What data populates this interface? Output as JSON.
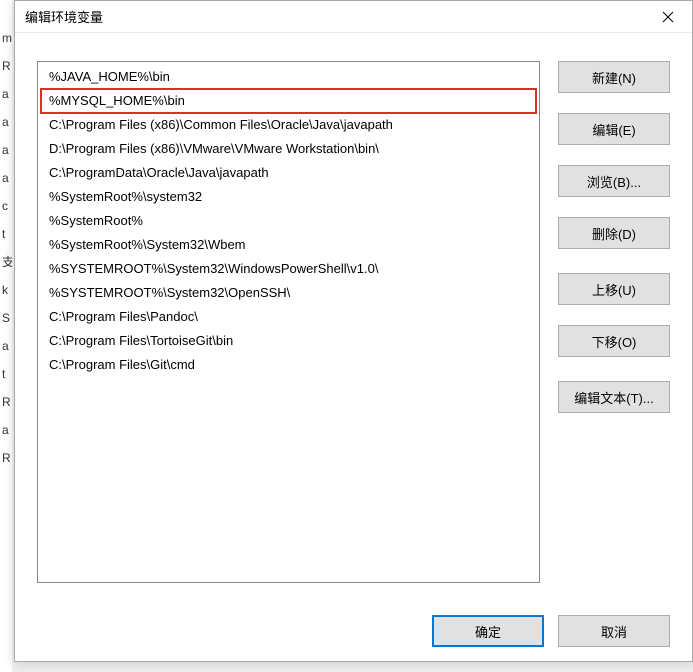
{
  "dialog": {
    "title": "编辑环境变量"
  },
  "list": {
    "items": [
      "%JAVA_HOME%\\bin",
      "%MYSQL_HOME%\\bin",
      "C:\\Program Files (x86)\\Common Files\\Oracle\\Java\\javapath",
      "D:\\Program Files (x86)\\VMware\\VMware Workstation\\bin\\",
      "C:\\ProgramData\\Oracle\\Java\\javapath",
      "%SystemRoot%\\system32",
      "%SystemRoot%",
      "%SystemRoot%\\System32\\Wbem",
      "%SYSTEMROOT%\\System32\\WindowsPowerShell\\v1.0\\",
      "%SYSTEMROOT%\\System32\\OpenSSH\\",
      "C:\\Program Files\\Pandoc\\",
      "C:\\Program Files\\TortoiseGit\\bin",
      "C:\\Program Files\\Git\\cmd"
    ],
    "highlighted_index": 1
  },
  "buttons": {
    "new": "新建(N)",
    "edit": "编辑(E)",
    "browse": "浏览(B)...",
    "delete": "删除(D)",
    "moveup": "上移(U)",
    "movedown": "下移(O)",
    "edittext": "编辑文本(T)..."
  },
  "footer": {
    "ok": "确定",
    "cancel": "取消"
  },
  "bg_fragments": [
    "m",
    "R",
    "a",
    "a",
    "a",
    "",
    "a",
    "c",
    "t",
    "",
    "",
    "",
    "支",
    "k",
    "S",
    "a",
    "",
    "t",
    "",
    "R",
    "",
    "a",
    "R"
  ]
}
